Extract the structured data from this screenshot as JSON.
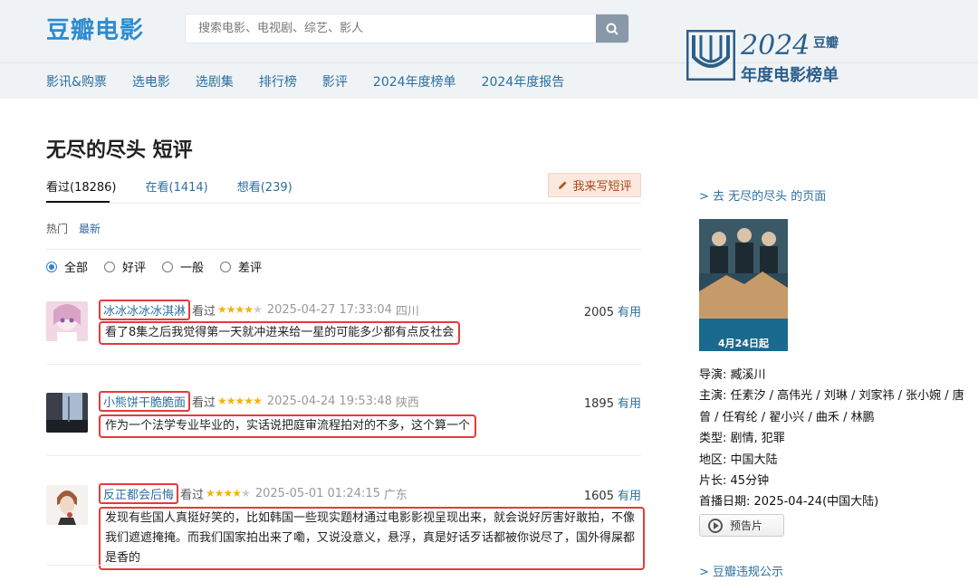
{
  "header": {
    "logo": "豆瓣电影",
    "search_placeholder": "搜索电影、电视剧、综艺、影人",
    "nav": [
      "影讯&购票",
      "选电影",
      "选剧集",
      "排行榜",
      "影评",
      "2024年度榜单",
      "2024年度报告"
    ],
    "promo": {
      "year": "2024",
      "brand": "豆瓣",
      "subtitle": "年度电影榜单"
    }
  },
  "main": {
    "title": "无尽的尽头 短评",
    "tabs": [
      "看过(18286)",
      "在看(1414)",
      "想看(239)"
    ],
    "write_button": "我来写短评",
    "sort": {
      "hot": "热门",
      "new": "最新"
    },
    "filters": [
      "全部",
      "好评",
      "一般",
      "差评"
    ],
    "selected_filter": "全部",
    "reviews": [
      {
        "user": "冰冰冰冰冰淇淋",
        "status": "看过",
        "rating": 4,
        "time": "2025-04-27 17:33:04",
        "location": "四川",
        "votes": "2005",
        "useful": "有用",
        "comment": "看了8集之后我觉得第一天就冲进来给一星的可能多少都有点反社会"
      },
      {
        "user": "小熊饼干脆脆面",
        "status": "看过",
        "rating": 5,
        "time": "2025-04-24 19:53:48",
        "location": "陕西",
        "votes": "1895",
        "useful": "有用",
        "comment": "作为一个法学专业毕业的，实话说把庭审流程拍对的不多，这个算一个"
      },
      {
        "user": "反正都会后悔",
        "status": "看过",
        "rating": 4,
        "time": "2025-05-01 01:24:15",
        "location": "广东",
        "votes": "1605",
        "useful": "有用",
        "comment": "发现有些国人真挺好笑的，比如韩国一些现实题材通过电影影视呈现出来，就会说好厉害好敢拍，不像我们遮遮掩掩。而我们国家拍出来了嘞，又说没意义，悬浮，真是好话歹话都被你说尽了，国外得屎都是香的"
      }
    ]
  },
  "sidebar": {
    "back_link": "> 去 无尽的尽头 的页面",
    "poster_date": "4月24日起",
    "info": [
      {
        "key": "导演",
        "value": "臧溪川"
      },
      {
        "key": "主演",
        "value": "任素汐 / 高伟光 / 刘琳 / 刘家祎 / 张小婉 / 唐曾 / 任宥纶 / 翟小兴 / 曲禾 / 林鹏"
      },
      {
        "key": "类型",
        "value": "剧情, 犯罪"
      },
      {
        "key": "地区",
        "value": "中国大陆"
      },
      {
        "key": "片长",
        "value": "45分钟"
      },
      {
        "key": "首播日期",
        "value": "2025-04-24(中国大陆)"
      }
    ],
    "trailer": "预告片",
    "report_link": "> 豆瓣违规公示"
  }
}
